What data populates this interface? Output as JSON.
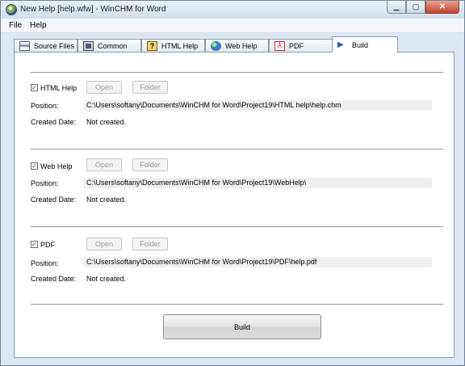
{
  "window": {
    "title": "New Help [help.wfw] - WinCHM for Word"
  },
  "menu": {
    "file": "File",
    "help": "Help"
  },
  "tabs": [
    {
      "label": "Source Files",
      "icon": "source-files-icon"
    },
    {
      "label": "Common",
      "icon": "common-icon"
    },
    {
      "label": "HTML Help",
      "icon": "html-help-icon"
    },
    {
      "label": "Web Help",
      "icon": "web-help-icon"
    },
    {
      "label": "PDF",
      "icon": "pdf-icon"
    },
    {
      "label": "Build",
      "icon": "build-icon",
      "active": true
    }
  ],
  "labels": {
    "position": "Position:",
    "created_date": "Created Date:",
    "open": "Open",
    "folder": "Folder"
  },
  "sections": [
    {
      "name": "HTML Help",
      "checked": true,
      "position": "C:\\Users\\softany\\Documents\\WinCHM for Word\\Project19\\HTML help\\help.chm",
      "created": "Not created."
    },
    {
      "name": "Web Help",
      "checked": true,
      "position": "C:\\Users\\softany\\Documents\\WinCHM for Word\\Project19\\WebHelp\\",
      "created": "Not created."
    },
    {
      "name": "PDF",
      "checked": true,
      "position": "C:\\Users\\softany\\Documents\\WinCHM for Word\\Project19\\PDF\\help.pdf",
      "created": "Not created."
    }
  ],
  "build_button": "Build"
}
